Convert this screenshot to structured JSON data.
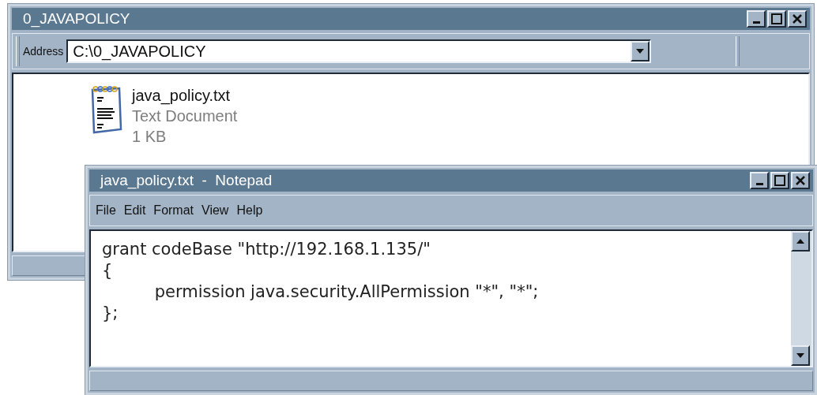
{
  "explorer": {
    "title": "0_JAVAPOLICY",
    "address_label": "Address",
    "address": "C:\\0_JAVAPOLICY",
    "file": {
      "name": "java_policy.txt",
      "type": "Text Document",
      "size": "1 KB"
    }
  },
  "notepad": {
    "title": "java_policy.txt  -  Notepad",
    "menu": [
      "File",
      "Edit",
      "Format",
      "View",
      "Help"
    ],
    "lines": [
      "grant codeBase \"http://192.168.1.135/\"",
      "{",
      "\tpermission java.security.AllPermission \"*\", \"*\";",
      "};"
    ]
  }
}
